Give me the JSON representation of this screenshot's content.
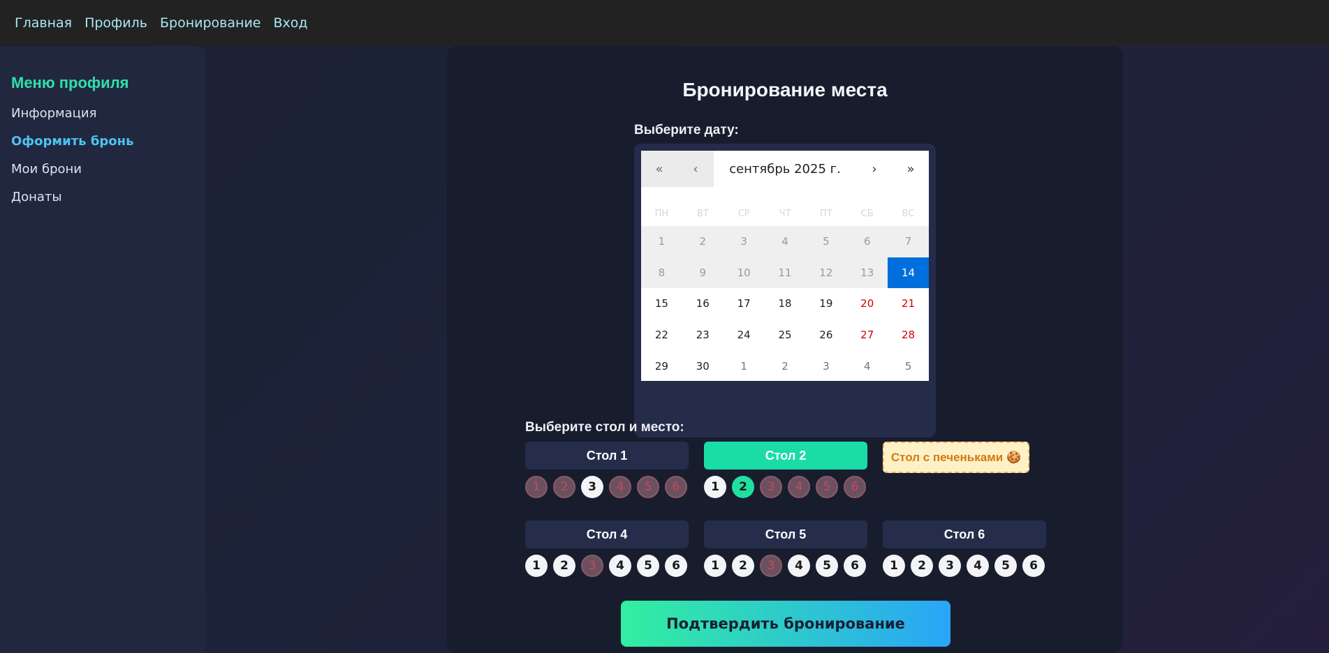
{
  "nav": [
    "Главная",
    "Профиль",
    "Бронирование",
    "Вход"
  ],
  "sidebar": {
    "title": "Меню профиля",
    "items": [
      {
        "label": "Информация",
        "active": false
      },
      {
        "label": "Оформить бронь",
        "active": true
      },
      {
        "label": "Мои брони",
        "active": false
      },
      {
        "label": "Донаты",
        "active": false
      }
    ]
  },
  "main": {
    "title": "Бронирование места",
    "date_label": "Выберите дату:",
    "table_label": "Выберите стол и место:",
    "confirm_label": "Подтвердить бронирование"
  },
  "calendar": {
    "nav": {
      "first": "«",
      "prev": "‹",
      "next": "›",
      "last": "»"
    },
    "month": "сентябрь 2025 г.",
    "weekdays": [
      "ПН",
      "ВТ",
      "СР",
      "ЧТ",
      "ПТ",
      "СБ",
      "ВС"
    ],
    "days": [
      {
        "n": "1",
        "s": "past"
      },
      {
        "n": "2",
        "s": "past"
      },
      {
        "n": "3",
        "s": "past"
      },
      {
        "n": "4",
        "s": "past"
      },
      {
        "n": "5",
        "s": "past"
      },
      {
        "n": "6",
        "s": "past"
      },
      {
        "n": "7",
        "s": "past"
      },
      {
        "n": "8",
        "s": "past"
      },
      {
        "n": "9",
        "s": "past"
      },
      {
        "n": "10",
        "s": "past"
      },
      {
        "n": "11",
        "s": "past"
      },
      {
        "n": "12",
        "s": "past"
      },
      {
        "n": "13",
        "s": "past"
      },
      {
        "n": "14",
        "s": "sel"
      },
      {
        "n": "15",
        "s": ""
      },
      {
        "n": "16",
        "s": ""
      },
      {
        "n": "17",
        "s": ""
      },
      {
        "n": "18",
        "s": ""
      },
      {
        "n": "19",
        "s": ""
      },
      {
        "n": "20",
        "s": "weekend"
      },
      {
        "n": "21",
        "s": "weekend"
      },
      {
        "n": "22",
        "s": ""
      },
      {
        "n": "23",
        "s": ""
      },
      {
        "n": "24",
        "s": ""
      },
      {
        "n": "25",
        "s": ""
      },
      {
        "n": "26",
        "s": ""
      },
      {
        "n": "27",
        "s": "weekend"
      },
      {
        "n": "28",
        "s": "weekend"
      },
      {
        "n": "29",
        "s": ""
      },
      {
        "n": "30",
        "s": ""
      },
      {
        "n": "1",
        "s": "other"
      },
      {
        "n": "2",
        "s": "other"
      },
      {
        "n": "3",
        "s": "other"
      },
      {
        "n": "4",
        "s": "other"
      },
      {
        "n": "5",
        "s": "other"
      }
    ]
  },
  "tables": [
    {
      "name": "Стол 1",
      "state": "normal",
      "seats": [
        {
          "n": "1",
          "s": "taken"
        },
        {
          "n": "2",
          "s": "taken"
        },
        {
          "n": "3",
          "s": "free"
        },
        {
          "n": "4",
          "s": "taken"
        },
        {
          "n": "5",
          "s": "taken"
        },
        {
          "n": "6",
          "s": "taken"
        }
      ]
    },
    {
      "name": "Стол 2",
      "state": "active",
      "seats": [
        {
          "n": "1",
          "s": "free"
        },
        {
          "n": "2",
          "s": "picked"
        },
        {
          "n": "3",
          "s": "taken"
        },
        {
          "n": "4",
          "s": "taken"
        },
        {
          "n": "5",
          "s": "taken"
        },
        {
          "n": "6",
          "s": "taken"
        }
      ]
    },
    {
      "name": "Стол с печеньками 🍪",
      "state": "cookie",
      "seats": []
    },
    {
      "name": "Стол 4",
      "state": "normal",
      "seats": [
        {
          "n": "1",
          "s": "free"
        },
        {
          "n": "2",
          "s": "free"
        },
        {
          "n": "3",
          "s": "taken"
        },
        {
          "n": "4",
          "s": "free"
        },
        {
          "n": "5",
          "s": "free"
        },
        {
          "n": "6",
          "s": "free"
        }
      ]
    },
    {
      "name": "Стол 5",
      "state": "normal",
      "seats": [
        {
          "n": "1",
          "s": "free"
        },
        {
          "n": "2",
          "s": "free"
        },
        {
          "n": "3",
          "s": "taken"
        },
        {
          "n": "4",
          "s": "free"
        },
        {
          "n": "5",
          "s": "free"
        },
        {
          "n": "6",
          "s": "free"
        }
      ]
    },
    {
      "name": "Стол 6",
      "state": "normal",
      "seats": [
        {
          "n": "1",
          "s": "free"
        },
        {
          "n": "2",
          "s": "free"
        },
        {
          "n": "3",
          "s": "free"
        },
        {
          "n": "4",
          "s": "free"
        },
        {
          "n": "5",
          "s": "free"
        },
        {
          "n": "6",
          "s": "free"
        }
      ]
    }
  ],
  "colors": {
    "accent": "#1bdca7",
    "selected_day": "#006edc",
    "weekend": "#d10000",
    "link": "#4cc3f0"
  }
}
